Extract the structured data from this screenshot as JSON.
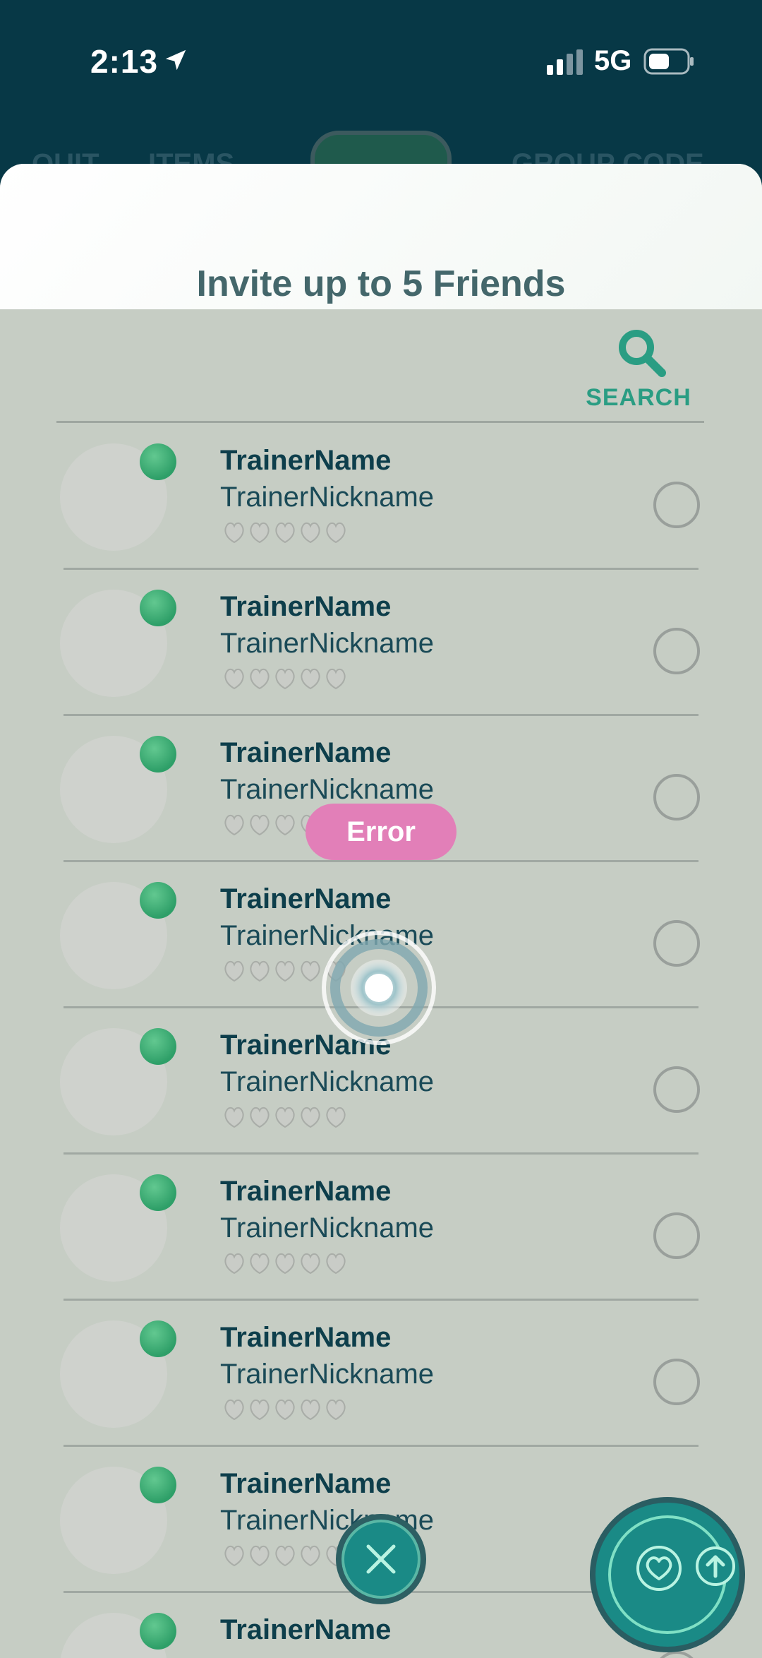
{
  "status_bar": {
    "time": "2:13",
    "network": "5G",
    "icons": [
      "location-arrow-icon",
      "signal-icon",
      "battery-icon"
    ]
  },
  "background_tabs": {
    "left": "QUIT",
    "middle_left": "ITEMS",
    "right": "GROUP CODE"
  },
  "sheet": {
    "title": "Invite up to 5 Friends",
    "search_label": "SEARCH"
  },
  "friends": [
    {
      "name": "TrainerName",
      "nickname": "TrainerNickname",
      "hearts": 0,
      "online": true,
      "selected": false
    },
    {
      "name": "TrainerName",
      "nickname": "TrainerNickname",
      "hearts": 0,
      "online": true,
      "selected": false
    },
    {
      "name": "TrainerName",
      "nickname": "TrainerNickname",
      "hearts": 0,
      "online": true,
      "selected": false
    },
    {
      "name": "TrainerName",
      "nickname": "TrainerNickname",
      "hearts": 0,
      "online": true,
      "selected": false
    },
    {
      "name": "TrainerName",
      "nickname": "TrainerNickname",
      "hearts": 0,
      "online": true,
      "selected": false
    },
    {
      "name": "TrainerName",
      "nickname": "TrainerNickname",
      "hearts": 0,
      "online": true,
      "selected": false
    },
    {
      "name": "TrainerName",
      "nickname": "TrainerNickname",
      "hearts": 0,
      "online": true,
      "selected": false
    },
    {
      "name": "TrainerName",
      "nickname": "TrainerNickname",
      "hearts": 0,
      "online": true,
      "selected": false
    },
    {
      "name": "TrainerName",
      "nickname": "",
      "hearts": 0,
      "online": true,
      "selected": false
    }
  ],
  "toast": {
    "label": "Error"
  },
  "colors": {
    "header_bg": "#073846",
    "accent": "#2a9d83",
    "error": "#e27fb8",
    "online": "#2e9f68",
    "button_teal": "#1a8a86"
  }
}
